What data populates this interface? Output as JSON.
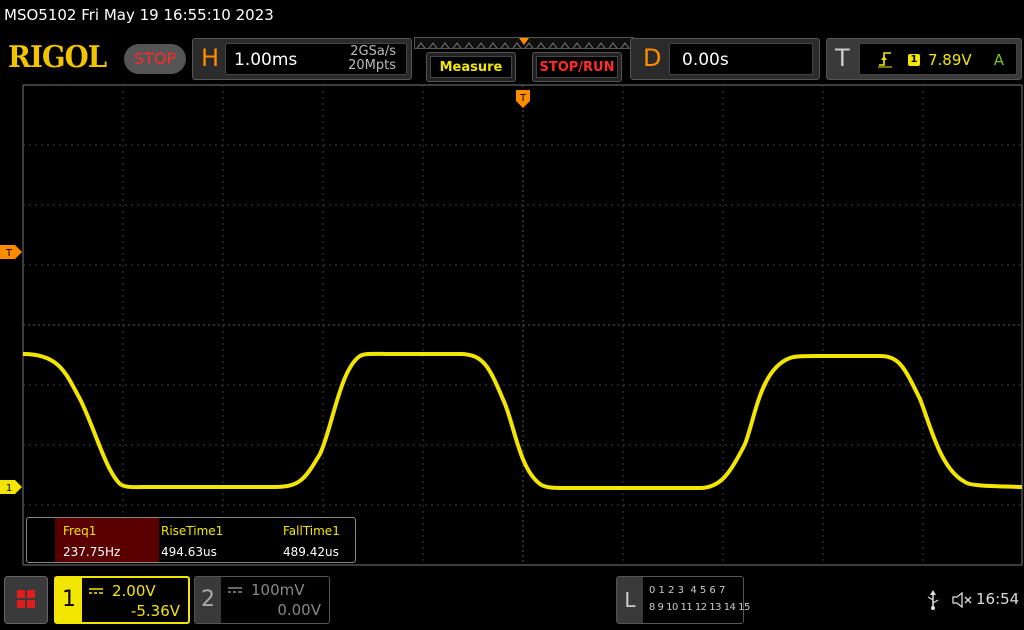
{
  "header": {
    "title_line": "MSO5102  Fri May 19 16:55:10 2023",
    "logo": "RIGOL",
    "run_state": "STOP"
  },
  "horizontal": {
    "letter": "H",
    "timebase": "1.00ms",
    "sample_rate": "2GSa/s",
    "memory_depth": "20Mpts"
  },
  "softkeys": {
    "measure": "Measure",
    "stop_run": "STOP/RUN"
  },
  "delay": {
    "letter": "D",
    "value": "0.00s"
  },
  "trigger": {
    "letter": "T",
    "source": "1",
    "level": "7.89V",
    "sweep_mode": "A"
  },
  "markers": {
    "trigger_top": "T",
    "trigger_level": "T",
    "ch1_ref": "1"
  },
  "measurements": [
    {
      "name": "Freq1",
      "value": "237.75Hz"
    },
    {
      "name": "RiseTime1",
      "value": "494.63us"
    },
    {
      "name": "FallTime1",
      "value": "489.42us"
    }
  ],
  "channels": {
    "ch1": {
      "number": "1",
      "scale": "2.00V",
      "offset": "-5.36V"
    },
    "ch2": {
      "number": "2",
      "scale": "100mV",
      "offset": "0.00V"
    }
  },
  "logic": {
    "letter": "L",
    "row1": "0 1 2 3  4 5 6 7",
    "row2": "8 9 10 11 12 13 14 15"
  },
  "status": {
    "time": "16:54"
  },
  "colors": {
    "ch1": "#f2e600",
    "trigger": "#ff8c00",
    "stop": "#ff2a2a",
    "grid": "#4a4a4a"
  },
  "icons": [
    "menu-icon",
    "usb-icon",
    "speaker-muted-icon",
    "rising-edge-icon",
    "dc-coupling-icon"
  ]
}
